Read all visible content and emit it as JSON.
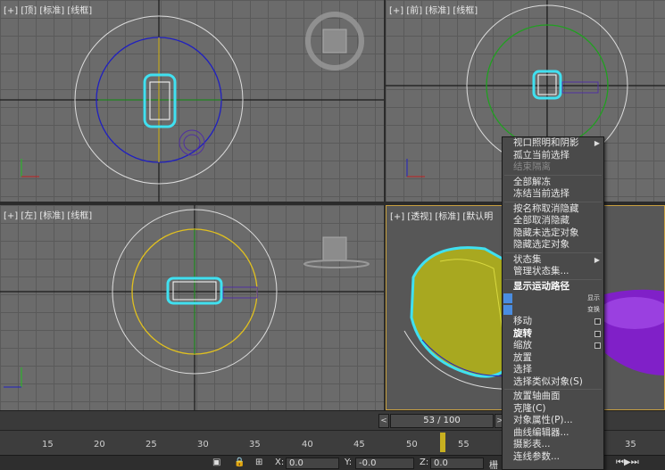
{
  "viewports": {
    "top": "[+] [顶] [标准] [线框]",
    "front": "[+] [前] [标准] [线框]",
    "left": "[+] [左] [标准] [线框]",
    "persp": "[+] [透视] [标准] [默认明"
  },
  "timeline": {
    "frame": "53 / 100",
    "prev": "<",
    "next": ">",
    "ticks": [
      "15",
      "20",
      "25",
      "30",
      "35",
      "40",
      "45",
      "50",
      "55",
      "35"
    ]
  },
  "statusbar": {
    "x_label": "X:",
    "x_value": "0.0",
    "y_label": "Y:",
    "y_value": "-0.0",
    "z_label": "Z:",
    "z_value": "0.0",
    "grid": "栅"
  },
  "menu": {
    "items": [
      {
        "label": "视口照明和阴影",
        "state": "normal",
        "arrow": true
      },
      {
        "label": "孤立当前选择",
        "state": "normal"
      },
      {
        "label": "结束隔离",
        "state": "disabled"
      },
      {
        "label": "全部解冻",
        "state": "normal"
      },
      {
        "label": "冻结当前选择",
        "state": "normal"
      },
      {
        "label": "按名称取消隐藏",
        "state": "normal"
      },
      {
        "label": "全部取消隐藏",
        "state": "normal"
      },
      {
        "label": "隐藏未选定对象",
        "state": "normal"
      },
      {
        "label": "隐藏选定对象",
        "state": "normal"
      },
      {
        "label": "状态集",
        "state": "normal",
        "arrow": true
      },
      {
        "label": "管理状态集...",
        "state": "normal"
      },
      {
        "label": "显示运动路径",
        "state": "bold"
      },
      {
        "label": "移动",
        "state": "normal",
        "box": true
      },
      {
        "label": "旋转",
        "state": "bold",
        "box": true
      },
      {
        "label": "缩放",
        "state": "normal",
        "box": true
      },
      {
        "label": "放置",
        "state": "normal"
      },
      {
        "label": "选择",
        "state": "normal"
      },
      {
        "label": "选择类似对象(S)",
        "state": "normal"
      },
      {
        "label": "放置轴曲面",
        "state": "normal"
      },
      {
        "label": "克隆(C)",
        "state": "normal"
      },
      {
        "label": "对象属性(P)...",
        "state": "normal"
      },
      {
        "label": "曲线编辑器...",
        "state": "normal"
      },
      {
        "label": "摄影表...",
        "state": "normal"
      },
      {
        "label": "连线参数...",
        "state": "normal"
      }
    ],
    "quad1": "显示",
    "quad2": "变换"
  }
}
